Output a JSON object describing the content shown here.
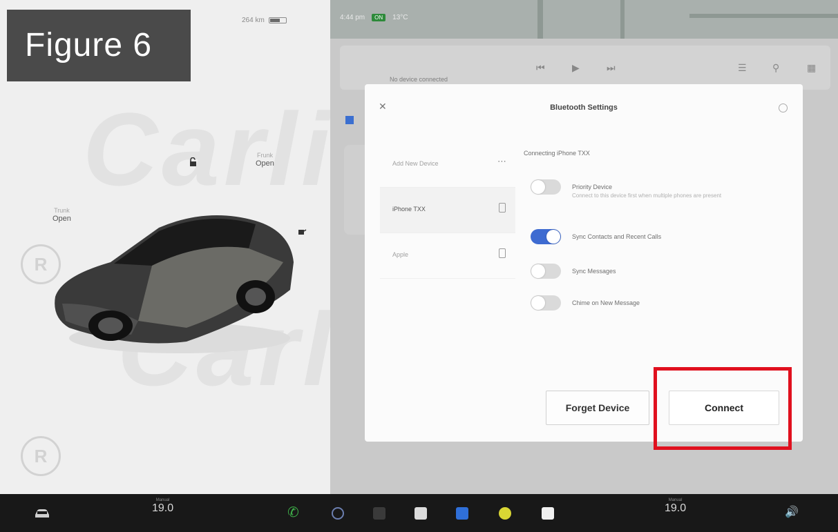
{
  "figure_label": "Figure 6",
  "watermark": {
    "text": "Carlinkit",
    "logo_letter": "R"
  },
  "car_status": {
    "range": "264 km",
    "front_trunk": {
      "caption": "Frunk",
      "state": "Open"
    },
    "rear_trunk": {
      "caption": "Trunk",
      "state": "Open"
    }
  },
  "top_status": {
    "time": "4:44 pm",
    "badge": "ON",
    "temp": "13°C"
  },
  "media": {
    "source": "No device connected"
  },
  "dialog": {
    "title": "Bluetooth Settings",
    "close_icon": "close-icon",
    "devices": [
      {
        "name": "Add New Device",
        "trailing": "more"
      },
      {
        "name": "iPhone TXX",
        "trailing": "phone"
      },
      {
        "name": "Apple",
        "trailing": "phone"
      }
    ],
    "connecting_text": "Connecting iPhone TXX",
    "options": [
      {
        "label": "Priority Device",
        "desc": "Connect to this device first when multiple phones are present",
        "on": false
      },
      {
        "label": "Sync Contacts and Recent Calls",
        "desc": "",
        "on": true
      },
      {
        "label": "Sync Messages",
        "desc": "",
        "on": false
      },
      {
        "label": "Chime on New Message",
        "desc": "",
        "on": false
      }
    ],
    "forget_label": "Forget Device",
    "connect_label": "Connect"
  },
  "taskbar": {
    "left_temp": {
      "caption": "Manual",
      "value": "19.0"
    },
    "right_temp": {
      "caption": "Manual",
      "value": "19.0"
    }
  },
  "colors": {
    "accent": "#3e6bd1",
    "highlight": "#e0101e",
    "taskbar": "#181818"
  }
}
